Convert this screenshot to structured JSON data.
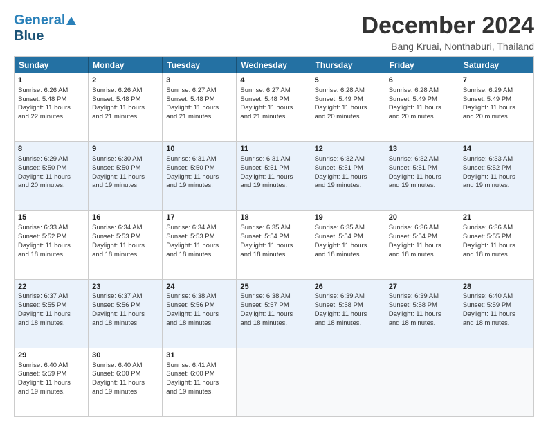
{
  "logo": {
    "part1": "General",
    "part2": "Blue"
  },
  "title": "December 2024",
  "subtitle": "Bang Kruai, Nonthaburi, Thailand",
  "days": [
    "Sunday",
    "Monday",
    "Tuesday",
    "Wednesday",
    "Thursday",
    "Friday",
    "Saturday"
  ],
  "rows": [
    [
      {
        "num": "1",
        "lines": [
          "Sunrise: 6:26 AM",
          "Sunset: 5:48 PM",
          "Daylight: 11 hours",
          "and 22 minutes."
        ]
      },
      {
        "num": "2",
        "lines": [
          "Sunrise: 6:26 AM",
          "Sunset: 5:48 PM",
          "Daylight: 11 hours",
          "and 21 minutes."
        ]
      },
      {
        "num": "3",
        "lines": [
          "Sunrise: 6:27 AM",
          "Sunset: 5:48 PM",
          "Daylight: 11 hours",
          "and 21 minutes."
        ]
      },
      {
        "num": "4",
        "lines": [
          "Sunrise: 6:27 AM",
          "Sunset: 5:48 PM",
          "Daylight: 11 hours",
          "and 21 minutes."
        ]
      },
      {
        "num": "5",
        "lines": [
          "Sunrise: 6:28 AM",
          "Sunset: 5:49 PM",
          "Daylight: 11 hours",
          "and 20 minutes."
        ]
      },
      {
        "num": "6",
        "lines": [
          "Sunrise: 6:28 AM",
          "Sunset: 5:49 PM",
          "Daylight: 11 hours",
          "and 20 minutes."
        ]
      },
      {
        "num": "7",
        "lines": [
          "Sunrise: 6:29 AM",
          "Sunset: 5:49 PM",
          "Daylight: 11 hours",
          "and 20 minutes."
        ]
      }
    ],
    [
      {
        "num": "8",
        "lines": [
          "Sunrise: 6:29 AM",
          "Sunset: 5:50 PM",
          "Daylight: 11 hours",
          "and 20 minutes."
        ]
      },
      {
        "num": "9",
        "lines": [
          "Sunrise: 6:30 AM",
          "Sunset: 5:50 PM",
          "Daylight: 11 hours",
          "and 19 minutes."
        ]
      },
      {
        "num": "10",
        "lines": [
          "Sunrise: 6:31 AM",
          "Sunset: 5:50 PM",
          "Daylight: 11 hours",
          "and 19 minutes."
        ]
      },
      {
        "num": "11",
        "lines": [
          "Sunrise: 6:31 AM",
          "Sunset: 5:51 PM",
          "Daylight: 11 hours",
          "and 19 minutes."
        ]
      },
      {
        "num": "12",
        "lines": [
          "Sunrise: 6:32 AM",
          "Sunset: 5:51 PM",
          "Daylight: 11 hours",
          "and 19 minutes."
        ]
      },
      {
        "num": "13",
        "lines": [
          "Sunrise: 6:32 AM",
          "Sunset: 5:51 PM",
          "Daylight: 11 hours",
          "and 19 minutes."
        ]
      },
      {
        "num": "14",
        "lines": [
          "Sunrise: 6:33 AM",
          "Sunset: 5:52 PM",
          "Daylight: 11 hours",
          "and 19 minutes."
        ]
      }
    ],
    [
      {
        "num": "15",
        "lines": [
          "Sunrise: 6:33 AM",
          "Sunset: 5:52 PM",
          "Daylight: 11 hours",
          "and 18 minutes."
        ]
      },
      {
        "num": "16",
        "lines": [
          "Sunrise: 6:34 AM",
          "Sunset: 5:53 PM",
          "Daylight: 11 hours",
          "and 18 minutes."
        ]
      },
      {
        "num": "17",
        "lines": [
          "Sunrise: 6:34 AM",
          "Sunset: 5:53 PM",
          "Daylight: 11 hours",
          "and 18 minutes."
        ]
      },
      {
        "num": "18",
        "lines": [
          "Sunrise: 6:35 AM",
          "Sunset: 5:54 PM",
          "Daylight: 11 hours",
          "and 18 minutes."
        ]
      },
      {
        "num": "19",
        "lines": [
          "Sunrise: 6:35 AM",
          "Sunset: 5:54 PM",
          "Daylight: 11 hours",
          "and 18 minutes."
        ]
      },
      {
        "num": "20",
        "lines": [
          "Sunrise: 6:36 AM",
          "Sunset: 5:54 PM",
          "Daylight: 11 hours",
          "and 18 minutes."
        ]
      },
      {
        "num": "21",
        "lines": [
          "Sunrise: 6:36 AM",
          "Sunset: 5:55 PM",
          "Daylight: 11 hours",
          "and 18 minutes."
        ]
      }
    ],
    [
      {
        "num": "22",
        "lines": [
          "Sunrise: 6:37 AM",
          "Sunset: 5:55 PM",
          "Daylight: 11 hours",
          "and 18 minutes."
        ]
      },
      {
        "num": "23",
        "lines": [
          "Sunrise: 6:37 AM",
          "Sunset: 5:56 PM",
          "Daylight: 11 hours",
          "and 18 minutes."
        ]
      },
      {
        "num": "24",
        "lines": [
          "Sunrise: 6:38 AM",
          "Sunset: 5:56 PM",
          "Daylight: 11 hours",
          "and 18 minutes."
        ]
      },
      {
        "num": "25",
        "lines": [
          "Sunrise: 6:38 AM",
          "Sunset: 5:57 PM",
          "Daylight: 11 hours",
          "and 18 minutes."
        ]
      },
      {
        "num": "26",
        "lines": [
          "Sunrise: 6:39 AM",
          "Sunset: 5:58 PM",
          "Daylight: 11 hours",
          "and 18 minutes."
        ]
      },
      {
        "num": "27",
        "lines": [
          "Sunrise: 6:39 AM",
          "Sunset: 5:58 PM",
          "Daylight: 11 hours",
          "and 18 minutes."
        ]
      },
      {
        "num": "28",
        "lines": [
          "Sunrise: 6:40 AM",
          "Sunset: 5:59 PM",
          "Daylight: 11 hours",
          "and 18 minutes."
        ]
      }
    ],
    [
      {
        "num": "29",
        "lines": [
          "Sunrise: 6:40 AM",
          "Sunset: 5:59 PM",
          "Daylight: 11 hours",
          "and 19 minutes."
        ]
      },
      {
        "num": "30",
        "lines": [
          "Sunrise: 6:40 AM",
          "Sunset: 6:00 PM",
          "Daylight: 11 hours",
          "and 19 minutes."
        ]
      },
      {
        "num": "31",
        "lines": [
          "Sunrise: 6:41 AM",
          "Sunset: 6:00 PM",
          "Daylight: 11 hours",
          "and 19 minutes."
        ]
      },
      {
        "num": "",
        "lines": []
      },
      {
        "num": "",
        "lines": []
      },
      {
        "num": "",
        "lines": []
      },
      {
        "num": "",
        "lines": []
      }
    ]
  ]
}
